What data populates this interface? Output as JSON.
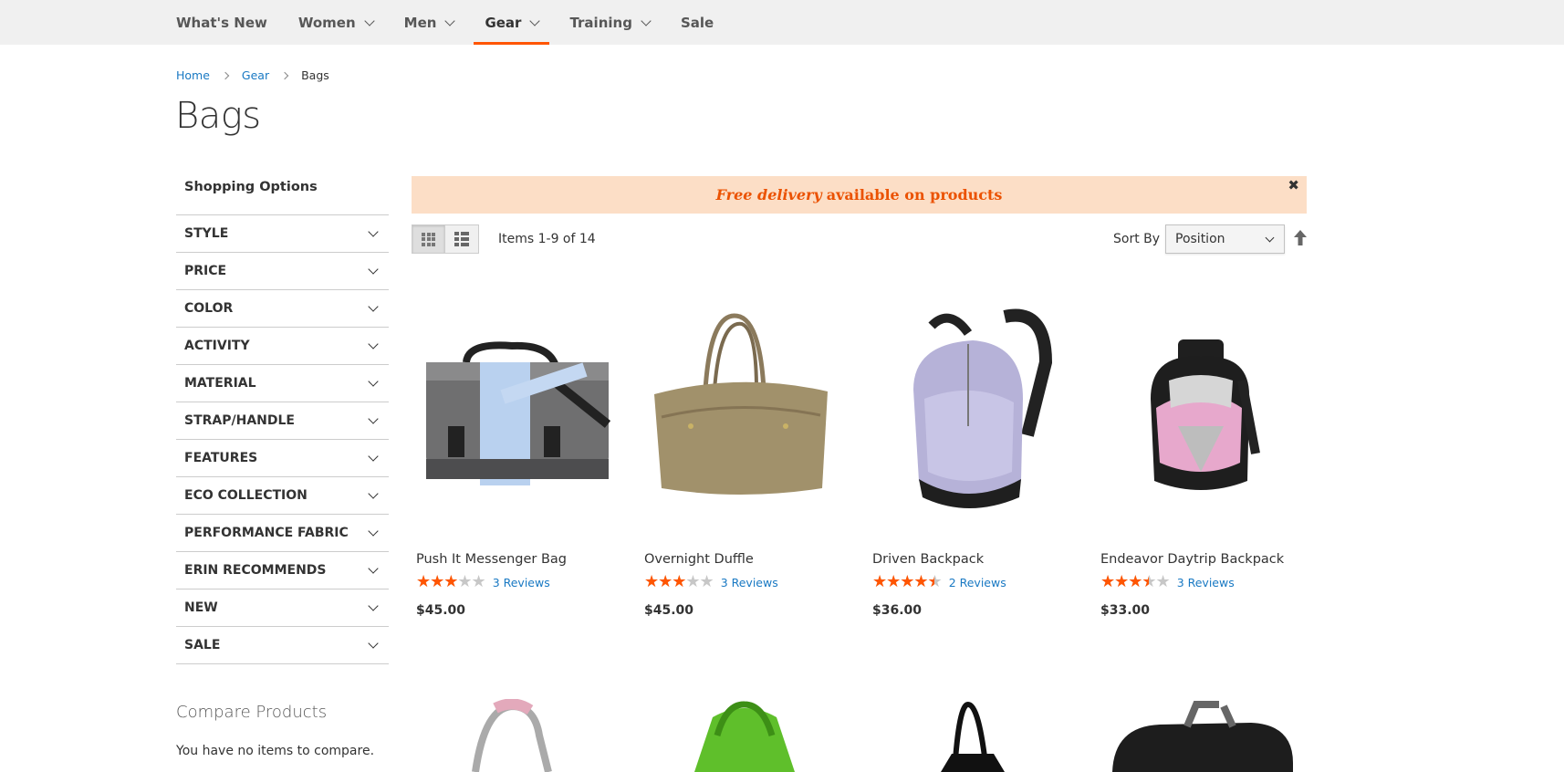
{
  "nav": {
    "items": [
      {
        "label": "What's New",
        "dropdown": false,
        "active": false
      },
      {
        "label": "Women",
        "dropdown": true,
        "active": false
      },
      {
        "label": "Men",
        "dropdown": true,
        "active": false
      },
      {
        "label": "Gear",
        "dropdown": true,
        "active": true
      },
      {
        "label": "Training",
        "dropdown": true,
        "active": false
      },
      {
        "label": "Sale",
        "dropdown": false,
        "active": false
      }
    ]
  },
  "breadcrumb": {
    "home": "Home",
    "gear": "Gear",
    "current": "Bags"
  },
  "page_title": "Bags",
  "sidebar": {
    "title": "Shopping Options",
    "filters": [
      "STYLE",
      "PRICE",
      "COLOR",
      "ACTIVITY",
      "MATERIAL",
      "STRAP/HANDLE",
      "FEATURES",
      "ECO COLLECTION",
      "PERFORMANCE FABRIC",
      "ERIN RECOMMENDS",
      "NEW",
      "SALE"
    ]
  },
  "compare": {
    "title": "Compare Products",
    "empty": "You have no items to compare."
  },
  "banner": {
    "emphasis": "Free delivery",
    "text": "available on products",
    "close": "✖"
  },
  "toolbar": {
    "items_count": "Items 1-9 of 14",
    "sort_label": "Sort By",
    "sort_value": "Position"
  },
  "products": [
    {
      "name": "Push It Messenger Bag",
      "rating_percent": 60,
      "reviews": "3 Reviews",
      "price": "$45.00"
    },
    {
      "name": "Overnight Duffle",
      "rating_percent": 60,
      "reviews": "3 Reviews",
      "price": "$45.00"
    },
    {
      "name": "Driven Backpack",
      "rating_percent": 90,
      "reviews": "2 Reviews",
      "price": "$36.00"
    },
    {
      "name": "Endeavor Daytrip Backpack",
      "rating_percent": 70,
      "reviews": "3 Reviews",
      "price": "$33.00"
    }
  ],
  "colors": {
    "accent": "#ff5501",
    "link": "#1979c3",
    "banner_bg": "#fcdec6",
    "banner_text": "#eb5202"
  }
}
